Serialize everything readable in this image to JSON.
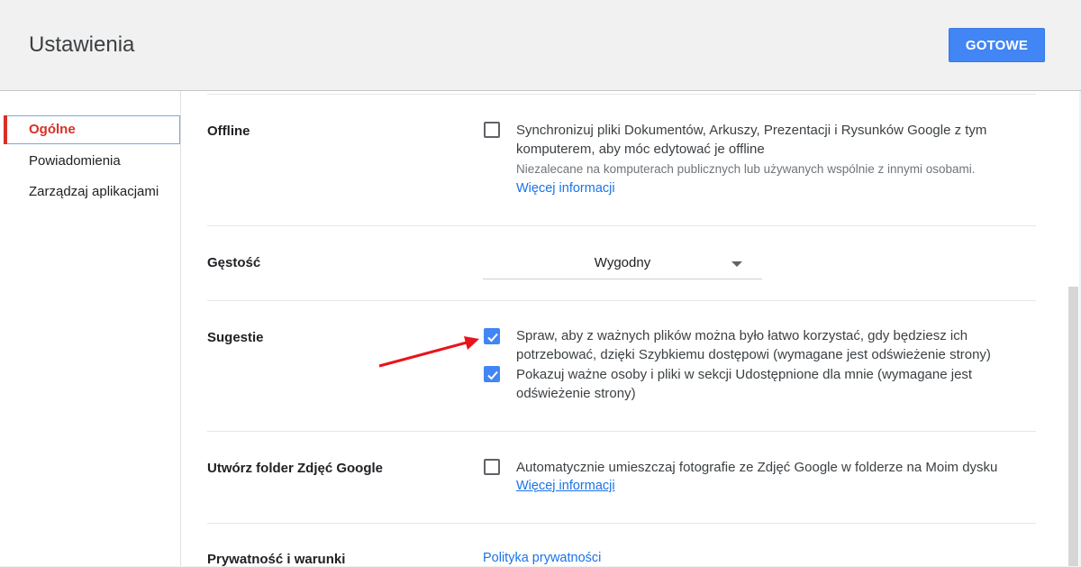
{
  "header": {
    "title": "Ustawienia",
    "done_label": "GOTOWE"
  },
  "sidebar": {
    "items": [
      {
        "label": "Ogólne",
        "active": true
      },
      {
        "label": "Powiadomienia",
        "active": false
      },
      {
        "label": "Zarządzaj aplikacjami",
        "active": false
      }
    ]
  },
  "settings": {
    "offline": {
      "label": "Offline",
      "checked": false,
      "text": "Synchronizuj pliki Dokumentów, Arkuszy, Prezentacji i Rysunków Google z tym komputerem, aby móc edytować je offline",
      "hint": "Niezalecane na komputerach publicznych lub używanych wspólnie z innymi osobami.",
      "link": "Więcej informacji"
    },
    "density": {
      "label": "Gęstość",
      "value": "Wygodny"
    },
    "suggestions": {
      "label": "Sugestie",
      "options": [
        {
          "checked": true,
          "text": "Spraw, aby z ważnych plików można było łatwo korzystać, gdy będziesz ich potrzebować, dzięki Szybkiemu dostępowi (wymagane jest odświeżenie strony)"
        },
        {
          "checked": true,
          "text": "Pokazuj ważne osoby i pliki w sekcji Udostępnione dla mnie (wymagane jest odświeżenie strony)"
        }
      ]
    },
    "photos_folder": {
      "label": "Utwórz folder Zdjęć Google",
      "checked": false,
      "text": "Automatycznie umieszczaj fotografie ze Zdjęć Google w folderze na Moim dysku",
      "link": "Więcej informacji"
    },
    "privacy": {
      "label": "Prywatność i warunki",
      "link": "Polityka prywatności"
    }
  },
  "colors": {
    "accent": "#4285f4",
    "active_nav": "#d93025",
    "link": "#1a73e8",
    "annotation_arrow": "#e8141b"
  }
}
